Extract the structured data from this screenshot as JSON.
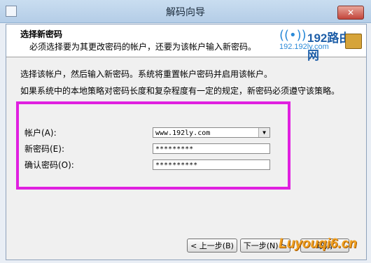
{
  "window": {
    "title": "解码向导",
    "close_label": "✕"
  },
  "header": {
    "title": "选择新密码",
    "subtitle": "必须选择要为其更改密码的帐户，还要为该帐户输入新密码。"
  },
  "logo": {
    "main": "192路由网",
    "sub": "192.192ly.com"
  },
  "instructions": {
    "line1": "选择该帐户，然后输入新密码。系统将重置帐户密码并启用该帐户。",
    "line2": "如果系统中的本地策略对密码长度和复杂程度有一定的规定，新密码必须遵守该策略。"
  },
  "form": {
    "account_label": "帐户(A):",
    "account_value": "www.192ly.com",
    "new_password_label": "新密码(E):",
    "new_password_value": "*********",
    "confirm_password_label": "确认密码(O):",
    "confirm_password_value": "**********"
  },
  "buttons": {
    "back": "< 上一步(B)",
    "next": "下一步(N) >",
    "cancel": "取消"
  },
  "watermark": "Luyouqi6.cn",
  "colors": {
    "highlight_border": "#e020e0"
  }
}
